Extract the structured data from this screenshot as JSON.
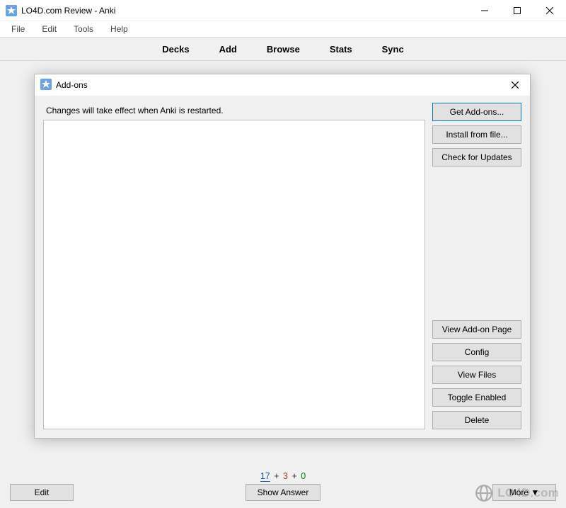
{
  "window": {
    "title": "LO4D.com Review - Anki"
  },
  "menu": {
    "file": "File",
    "edit": "Edit",
    "tools": "Tools",
    "help": "Help"
  },
  "tabs": {
    "decks": "Decks",
    "add": "Add",
    "browse": "Browse",
    "stats": "Stats",
    "sync": "Sync"
  },
  "dialog": {
    "title": "Add-ons",
    "message": "Changes will take effect when Anki is restarted.",
    "buttons": {
      "get": "Get Add-ons...",
      "install": "Install from file...",
      "updates": "Check for Updates",
      "view_page": "View Add-on Page",
      "config": "Config",
      "view_files": "View Files",
      "toggle": "Toggle Enabled",
      "delete": "Delete"
    }
  },
  "bottom": {
    "count_blue": "17",
    "count_red": "3",
    "count_green": "0",
    "edit": "Edit",
    "show_answer": "Show Answer",
    "more": "More ▼"
  },
  "watermark": {
    "text": "LO4D.com"
  }
}
